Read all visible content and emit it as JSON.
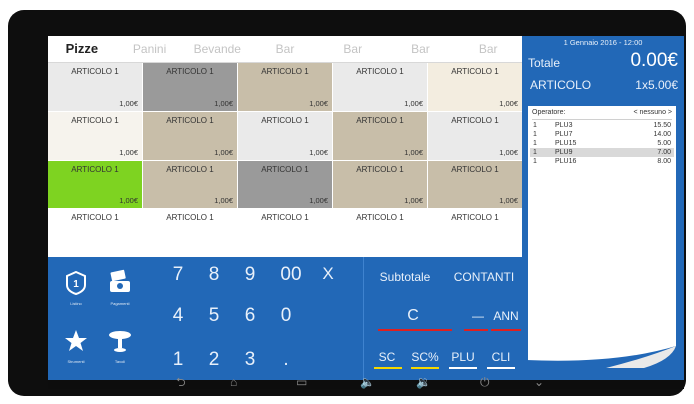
{
  "tabs": [
    "Pizze",
    "Panini",
    "Bevande",
    "Bar",
    "Bar",
    "Bar",
    "Bar"
  ],
  "products": [
    {
      "name": "ARTICOLO 1",
      "price": "1,00€",
      "color": "grey"
    },
    {
      "name": "ARTICOLO 1",
      "price": "1,00€",
      "color": "dgrey"
    },
    {
      "name": "ARTICOLO 1",
      "price": "1,00€",
      "color": "tan"
    },
    {
      "name": "ARTICOLO 1",
      "price": "1,00€",
      "color": "grey"
    },
    {
      "name": "ARTICOLO 1",
      "price": "1,00€",
      "color": "beige"
    },
    {
      "name": "ARTICOLO 1",
      "price": "1,00€",
      "color": "light"
    },
    {
      "name": "ARTICOLO 1",
      "price": "1,00€",
      "color": "tan"
    },
    {
      "name": "ARTICOLO 1",
      "price": "1,00€",
      "color": "grey"
    },
    {
      "name": "ARTICOLO 1",
      "price": "1,00€",
      "color": "tan"
    },
    {
      "name": "ARTICOLO 1",
      "price": "1,00€",
      "color": "grey"
    },
    {
      "name": "ARTICOLO 1",
      "price": "1,00€",
      "color": "green"
    },
    {
      "name": "ARTICOLO 1",
      "price": "1,00€",
      "color": "tan"
    },
    {
      "name": "ARTICOLO 1",
      "price": "1,00€",
      "color": "dgrey"
    },
    {
      "name": "ARTICOLO 1",
      "price": "1,00€",
      "color": "tan"
    },
    {
      "name": "ARTICOLO 1",
      "price": "1,00€",
      "color": "tan"
    },
    {
      "name": "ARTICOLO 1",
      "price": "",
      "color": "white"
    },
    {
      "name": "ARTICOLO 1",
      "price": "",
      "color": "white"
    },
    {
      "name": "ARTICOLO 1",
      "price": "",
      "color": "white"
    },
    {
      "name": "ARTICOLO 1",
      "price": "",
      "color": "white"
    },
    {
      "name": "ARTICOLO 1",
      "price": "",
      "color": "white"
    }
  ],
  "side_buttons": [
    {
      "caption": "Listino",
      "icon": "price-list-icon"
    },
    {
      "caption": "Pagamenti",
      "icon": "payments-icon"
    },
    {
      "caption": "Strumenti",
      "icon": "star-icon"
    },
    {
      "caption": "Tavoli",
      "icon": "table-icon"
    }
  ],
  "keypad": {
    "row1": [
      "7",
      "8",
      "9",
      "00",
      "X"
    ],
    "row2": [
      "4",
      "5",
      "6",
      "0"
    ],
    "row3": [
      "1",
      "2",
      "3",
      "."
    ]
  },
  "function_keys": {
    "subtotale": "Subtotale",
    "contanti": "CONTANTI",
    "c": "C",
    "minus": "—",
    "ann": "ANN",
    "sc": "SC",
    "sc_percent": "SC%",
    "plu": "PLU",
    "cli": "CLI"
  },
  "header": {
    "date": "1 Gennaio 2016 - 12:00",
    "totale_label": "Totale",
    "totale_value": "0.00€",
    "article_label": "ARTICOLO",
    "article_qty": "1x5.00€"
  },
  "receipt": {
    "operator_label": "Operatore:",
    "operator_value": "< nessuno >",
    "items": [
      {
        "qty": "1",
        "code": "PLU3",
        "price": "15.50",
        "selected": false
      },
      {
        "qty": "1",
        "code": "PLU7",
        "price": "14.00",
        "selected": false
      },
      {
        "qty": "1",
        "code": "PLU15",
        "price": "5.00",
        "selected": false
      },
      {
        "qty": "1",
        "code": "PLU9",
        "price": "7.00",
        "selected": true
      },
      {
        "qty": "1",
        "code": "PLU16",
        "price": "8.00",
        "selected": false
      }
    ]
  },
  "navbar_icons": [
    "back-icon",
    "home-icon",
    "recents-icon",
    "volume-down-icon",
    "volume-up-icon",
    "power-icon",
    "hide-icon"
  ],
  "colors": {
    "accent_blue": "#2268b7",
    "highlight_green": "#7ed321",
    "underline_red": "#e02020",
    "underline_yellow": "#f5d800"
  }
}
